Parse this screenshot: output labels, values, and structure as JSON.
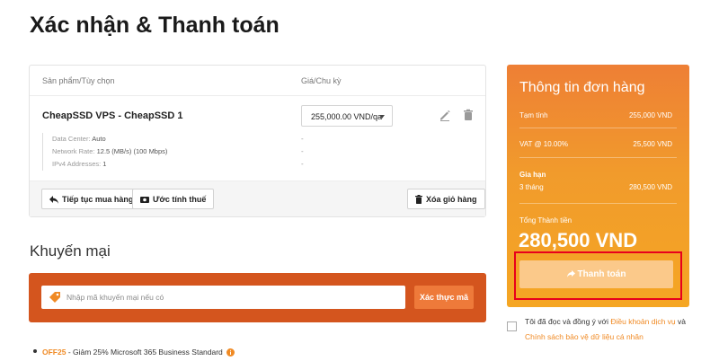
{
  "page": {
    "title": "Xác nhận & Thanh toán"
  },
  "cart": {
    "columns": {
      "product": "Sản phẩm/Tùy chọn",
      "price": "Giá/Chu kỳ"
    },
    "item": {
      "name": "CheapSSD VPS - CheapSSD 1",
      "price_select": "255,000.00 VND/qa",
      "specs": [
        {
          "label": "Data Center:",
          "value": "Auto",
          "price": "-"
        },
        {
          "label": "Network Rate:",
          "value": "12.5 (MB/s) (100 Mbps)",
          "price": "-"
        },
        {
          "label": "IPv4 Addresses:",
          "value": "1",
          "price": "-"
        }
      ]
    },
    "buttons": {
      "continue": "Tiếp tục mua hàng",
      "tax": "Ước tính thuế",
      "clear": "Xóa giỏ hàng"
    }
  },
  "promo": {
    "title": "Khuyến mại",
    "placeholder": "Nhập mã khuyến mại nếu có",
    "validate": "Xác thực mã",
    "offer_code": "OFF25",
    "offer_text": " - Giảm 25% Microsoft 365 Business Standard"
  },
  "summary": {
    "title": "Thông tin đơn hàng",
    "subtotal_label": "Tạm tính",
    "subtotal_value": "255,000 VND",
    "vat_label": "VAT @ 10.00%",
    "vat_value": "25,500 VND",
    "renewal_label": "Gia hạn",
    "renewal_period": "3 tháng",
    "renewal_value": "280,500 VND",
    "total_label": "Tổng Thành tiền",
    "total_value": "280,500 VND",
    "checkout": "Thanh toán"
  },
  "terms": {
    "prefix": "Tôi đã đọc và đồng ý với ",
    "link1": "Điều khoản dịch vụ",
    "middle": " và ",
    "link2": "Chính sách bảo vệ dữ liệu cá nhân"
  },
  "colors": {
    "accent": "#f08a24",
    "promo_bg": "#d4551e",
    "highlight": "#e8001c"
  }
}
